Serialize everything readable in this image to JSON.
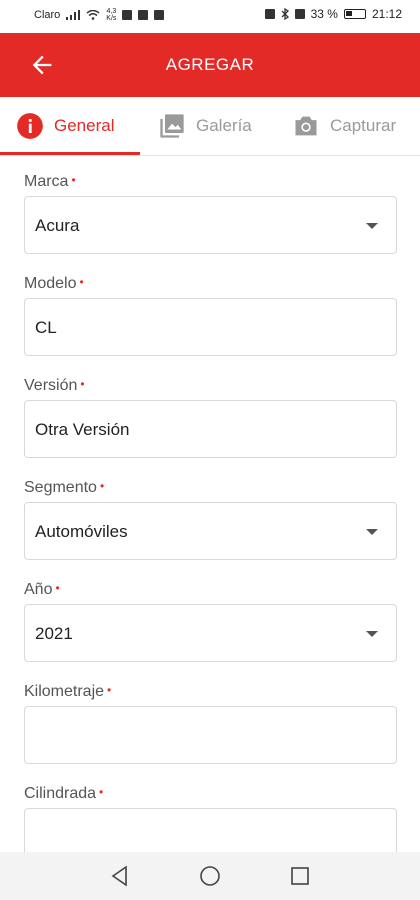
{
  "status_bar": {
    "carrier": "Claro",
    "speed_top": "4,3",
    "speed_bottom": "K/s",
    "battery": "33 %",
    "time": "21:12"
  },
  "app_bar": {
    "title": "AGREGAR"
  },
  "tabs": [
    {
      "label": "General",
      "icon": "info-icon",
      "active": true
    },
    {
      "label": "Galería",
      "icon": "gallery-icon",
      "active": false
    },
    {
      "label": "Capturar",
      "icon": "camera-icon",
      "active": false
    }
  ],
  "form": {
    "fields": [
      {
        "label": "Marca",
        "value": "Acura",
        "type": "dropdown"
      },
      {
        "label": "Modelo",
        "value": "CL",
        "type": "text"
      },
      {
        "label": "Versión",
        "value": "Otra Versión",
        "type": "text"
      },
      {
        "label": "Segmento",
        "value": "Automóviles",
        "type": "dropdown"
      },
      {
        "label": "Año",
        "value": "2021",
        "type": "dropdown"
      },
      {
        "label": "Kilometraje",
        "value": "",
        "type": "text"
      },
      {
        "label": "Cilindrada",
        "value": "",
        "type": "text"
      }
    ],
    "required_mark": "•"
  },
  "colors": {
    "primary": "#e42a27",
    "text": "#222222",
    "muted": "#9a9a9a"
  }
}
